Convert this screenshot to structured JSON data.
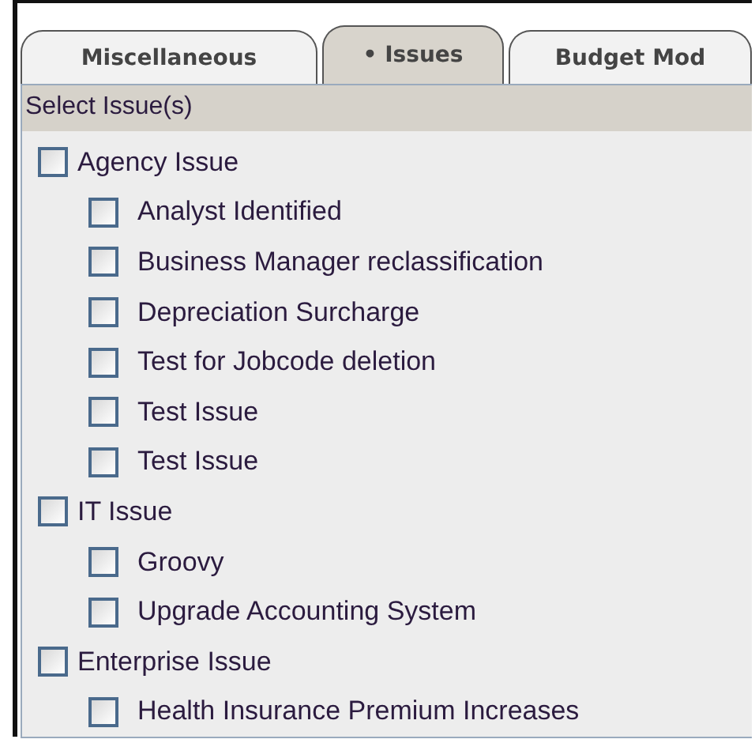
{
  "tabs": [
    {
      "label": "Miscellaneous",
      "selected": false
    },
    {
      "label": "• Issues",
      "selected": true
    },
    {
      "label": "Budget Mod",
      "selected": false
    }
  ],
  "panel": {
    "heading": "Select Issue(s)",
    "issues": [
      {
        "label": "Agency Issue",
        "checked": false,
        "children": [
          {
            "label": "Analyst Identified",
            "checked": false
          },
          {
            "label": "Business Manager reclassification",
            "checked": false
          },
          {
            "label": "Depreciation Surcharge",
            "checked": false
          },
          {
            "label": "Test for Jobcode deletion",
            "checked": false
          },
          {
            "label": "Test Issue",
            "checked": false
          },
          {
            "label": "Test Issue",
            "checked": false
          }
        ]
      },
      {
        "label": "IT Issue",
        "checked": false,
        "children": [
          {
            "label": "Groovy",
            "checked": false
          },
          {
            "label": "Upgrade Accounting System",
            "checked": false
          }
        ]
      },
      {
        "label": "Enterprise Issue",
        "checked": false,
        "children": [
          {
            "label": "Health Insurance Premium Increases",
            "checked": false
          }
        ]
      }
    ]
  }
}
